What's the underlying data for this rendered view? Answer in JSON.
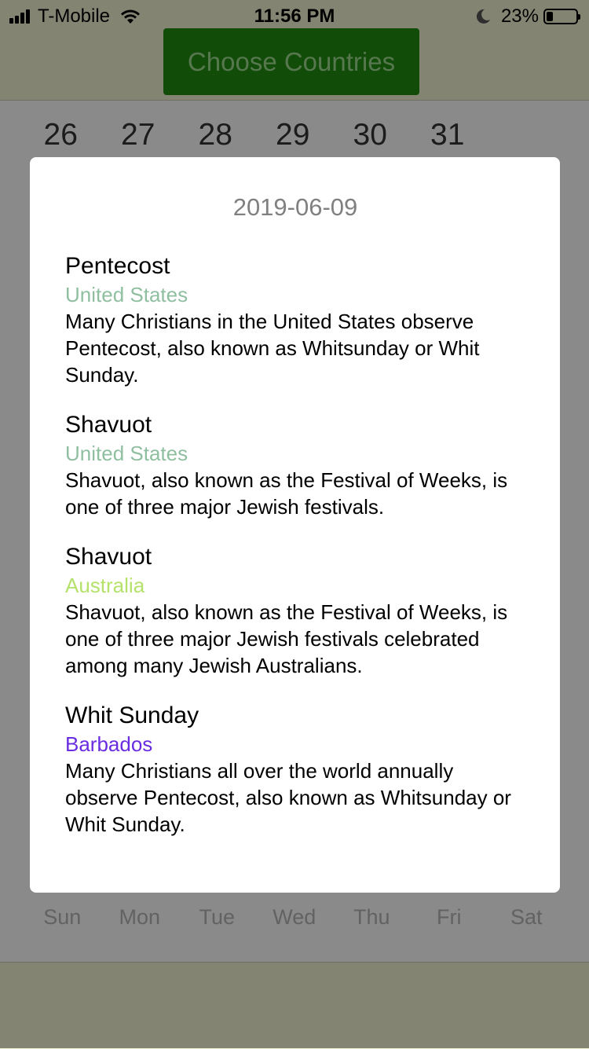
{
  "status_bar": {
    "carrier": "T-Mobile",
    "time": "11:56 PM",
    "battery": "23%",
    "battery_level": 0.23,
    "icons": [
      "signal-icon",
      "wifi-icon",
      "moon-icon",
      "battery-icon"
    ]
  },
  "header": {
    "choose_button_label": "Choose Countries",
    "accent": "#1f8a12"
  },
  "calendar": {
    "visible_dates": [
      "26",
      "27",
      "28",
      "29",
      "30",
      "31"
    ],
    "weekdays": [
      "Sun",
      "Mon",
      "Tue",
      "Wed",
      "Thu",
      "Fri",
      "Sat"
    ]
  },
  "modal": {
    "date": "2019-06-09",
    "holidays": [
      {
        "name": "Pentecost",
        "country": "United States",
        "country_color": "#8fbfa0",
        "description": "Many Christians in the United States observe Pentecost, also known as Whitsunday or Whit Sunday."
      },
      {
        "name": "Shavuot",
        "country": "United States",
        "country_color": "#8fbfa0",
        "description": "Shavuot, also known as the Festival of Weeks, is one of three major Jewish festivals."
      },
      {
        "name": "Shavuot",
        "country": "Australia",
        "country_color": "#b5e26a",
        "description": "Shavuot, also known as the Festival of Weeks, is one of three major Jewish festivals celebrated among many Jewish Australians."
      },
      {
        "name": "Whit Sunday",
        "country": "Barbados",
        "country_color": "#6a2ce0",
        "description": "Many Christians all over the world annually observe Pentecost, also known as Whitsunday or Whit Sunday."
      }
    ]
  }
}
